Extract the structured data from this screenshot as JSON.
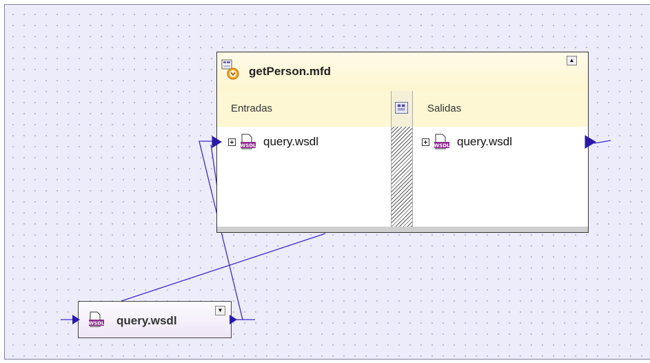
{
  "canvas": {
    "background": "#ececfb",
    "connector_color": "#3c2ac8"
  },
  "main_component": {
    "title": "getPerson.mfd",
    "header_bg": "#fdf7d3",
    "inputs_label": "Entradas",
    "outputs_label": "Salidas",
    "input_items": [
      {
        "name": "query.wsdl"
      }
    ],
    "output_items": [
      {
        "name": "query.wsdl"
      }
    ]
  },
  "source_component": {
    "title": "query.wsdl"
  },
  "icons": {
    "component": "mapping-component-icon",
    "item": "wsdl-file-icon",
    "expand": "plus-box-icon",
    "collapse": "collapse-triangle-icon",
    "splitter": "split-view-icon"
  }
}
